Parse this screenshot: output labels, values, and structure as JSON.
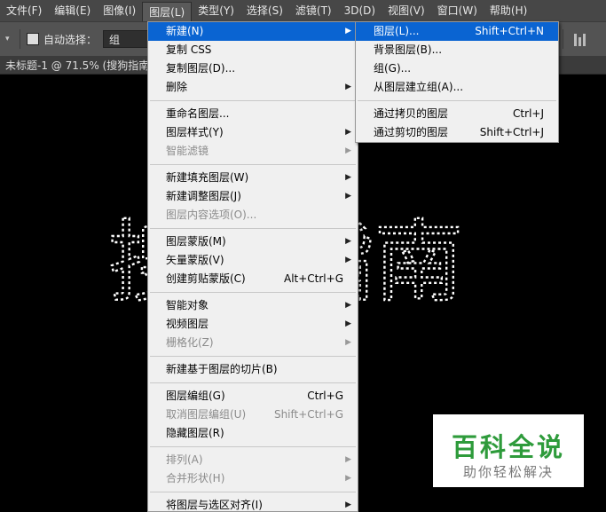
{
  "menubar": {
    "items": [
      "文件(F)",
      "编辑(E)",
      "图像(I)",
      "图层(L)",
      "类型(Y)",
      "选择(S)",
      "滤镜(T)",
      "3D(D)",
      "视图(V)",
      "窗口(W)",
      "帮助(H)"
    ]
  },
  "options": {
    "auto_select_label": "自动选择：",
    "auto_select_value": "组"
  },
  "document": {
    "tab_title": "未标题-1 @ 71.5% (搜狗指南"
  },
  "layer_menu": {
    "items": [
      {
        "label": "新建(N)",
        "shortcut": "",
        "submenu": true,
        "disabled": false,
        "highlighted": true
      },
      {
        "label": "复制 CSS",
        "shortcut": "",
        "submenu": false,
        "disabled": false
      },
      {
        "label": "复制图层(D)...",
        "shortcut": "",
        "submenu": false,
        "disabled": false
      },
      {
        "label": "删除",
        "shortcut": "",
        "submenu": true,
        "disabled": false
      },
      {
        "label": "重命名图层...",
        "shortcut": "",
        "submenu": false,
        "disabled": false
      },
      {
        "label": "图层样式(Y)",
        "shortcut": "",
        "submenu": true,
        "disabled": false
      },
      {
        "label": "智能滤镜",
        "shortcut": "",
        "submenu": true,
        "disabled": true
      },
      {
        "label": "新建填充图层(W)",
        "shortcut": "",
        "submenu": true,
        "disabled": false
      },
      {
        "label": "新建调整图层(J)",
        "shortcut": "",
        "submenu": true,
        "disabled": false
      },
      {
        "label": "图层内容选项(O)...",
        "shortcut": "",
        "submenu": false,
        "disabled": true
      },
      {
        "label": "图层蒙版(M)",
        "shortcut": "",
        "submenu": true,
        "disabled": false
      },
      {
        "label": "矢量蒙版(V)",
        "shortcut": "",
        "submenu": true,
        "disabled": false
      },
      {
        "label": "创建剪贴蒙版(C)",
        "shortcut": "Alt+Ctrl+G",
        "submenu": false,
        "disabled": false
      },
      {
        "label": "智能对象",
        "shortcut": "",
        "submenu": true,
        "disabled": false
      },
      {
        "label": "视频图层",
        "shortcut": "",
        "submenu": true,
        "disabled": false
      },
      {
        "label": "栅格化(Z)",
        "shortcut": "",
        "submenu": true,
        "disabled": true
      },
      {
        "label": "新建基于图层的切片(B)",
        "shortcut": "",
        "submenu": false,
        "disabled": false
      },
      {
        "label": "图层编组(G)",
        "shortcut": "Ctrl+G",
        "submenu": false,
        "disabled": false
      },
      {
        "label": "取消图层编组(U)",
        "shortcut": "Shift+Ctrl+G",
        "submenu": false,
        "disabled": true
      },
      {
        "label": "隐藏图层(R)",
        "shortcut": "",
        "submenu": false,
        "disabled": false
      },
      {
        "label": "排列(A)",
        "shortcut": "",
        "submenu": true,
        "disabled": true
      },
      {
        "label": "合并形状(H)",
        "shortcut": "",
        "submenu": true,
        "disabled": true
      },
      {
        "label": "将图层与选区对齐(I)",
        "shortcut": "",
        "submenu": true,
        "disabled": false
      }
    ]
  },
  "new_submenu": {
    "items": [
      {
        "label": "图层(L)...",
        "shortcut": "Shift+Ctrl+N",
        "highlighted": true
      },
      {
        "label": "背景图层(B)...",
        "shortcut": ""
      },
      {
        "label": "组(G)...",
        "shortcut": ""
      },
      {
        "label": "从图层建立组(A)...",
        "shortcut": ""
      },
      {
        "label": "通过拷贝的图层",
        "shortcut": "Ctrl+J"
      },
      {
        "label": "通过剪切的图层",
        "shortcut": "Shift+Ctrl+J"
      }
    ]
  },
  "canvas": {
    "text": "搜狗指南"
  },
  "watermark": {
    "title": "百科全说",
    "subtitle": "助你轻松解决"
  },
  "colors": {
    "menubar_bg": "#474747",
    "menu_bg": "#f0f0f0",
    "highlight": "#0a64d2",
    "watermark_green": "#2e9b3b"
  }
}
